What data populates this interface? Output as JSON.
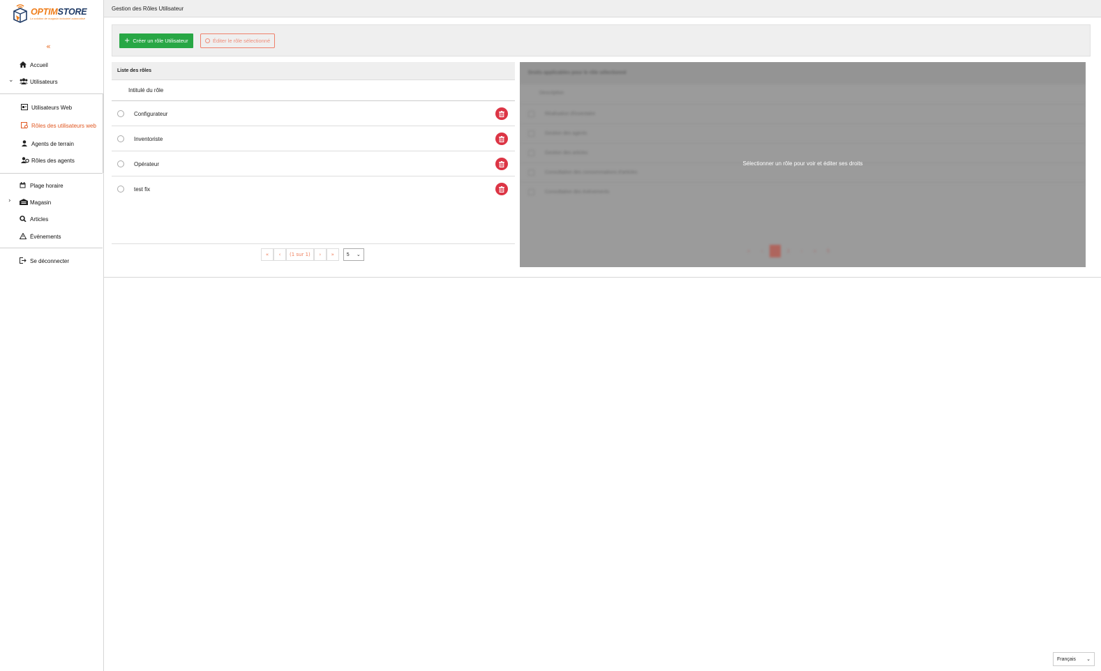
{
  "brand": {
    "name_part1": "OPTIM",
    "name_part2": "STORE",
    "tagline": "La solution de magasin industriel automatisé",
    "colors": {
      "orange": "#ef7d1a",
      "navy": "#1f3b66"
    }
  },
  "sidebar": {
    "collapse_icon": "«",
    "items": [
      {
        "label": "Accueil",
        "icon": "home-icon"
      },
      {
        "label": "Utilisateurs",
        "icon": "users-icon",
        "expanded": true
      },
      {
        "label": "Utilisateurs Web",
        "icon": "id-card-icon"
      },
      {
        "label": "Rôles des utilisateurs web",
        "icon": "user-role-icon",
        "active": true
      },
      {
        "label": "Agents de terrain",
        "icon": "user-icon"
      },
      {
        "label": "Rôles des agents",
        "icon": "users-gear-icon"
      },
      {
        "label": "Plage horaire",
        "icon": "calendar-icon"
      },
      {
        "label": "Magasin",
        "icon": "warehouse-icon",
        "expanded": false
      },
      {
        "label": "Articles",
        "icon": "search-box-icon"
      },
      {
        "label": "Événements",
        "icon": "warning-icon"
      },
      {
        "label": "Se déconnecter",
        "icon": "logout-icon"
      }
    ]
  },
  "header": {
    "title": "Gestion des Rôles Utilisateur"
  },
  "toolbar": {
    "create_label": "Créer un rôle Utilisateur",
    "edit_label": "Éditer le rôle sélectionné"
  },
  "roles_panel": {
    "title": "Liste des rôles",
    "column": "Intitulé du rôle",
    "rows": [
      "Configurateur",
      "Inventoriste",
      "Opérateur",
      "test fix"
    ],
    "pager": {
      "first": "«",
      "prev": "‹",
      "info": "(1 sur 1)",
      "next": "›",
      "last": "»",
      "page_size": "5"
    }
  },
  "rights_panel": {
    "title": "Droits applicables pour le rôle sélectionné",
    "column": "Description",
    "rows": [
      "Réalisation d'inventaire",
      "Gestion des agents",
      "Gestion des articles",
      "Consultation des consommations d'articles",
      "Consultation des événements"
    ],
    "pager_pages": [
      "«",
      "‹",
      "1",
      "2",
      "›",
      "»",
      "5"
    ],
    "overlay_message": "Sélectionner un rôle pour voir et éditer ses droits"
  },
  "language": {
    "selected": "Français"
  }
}
